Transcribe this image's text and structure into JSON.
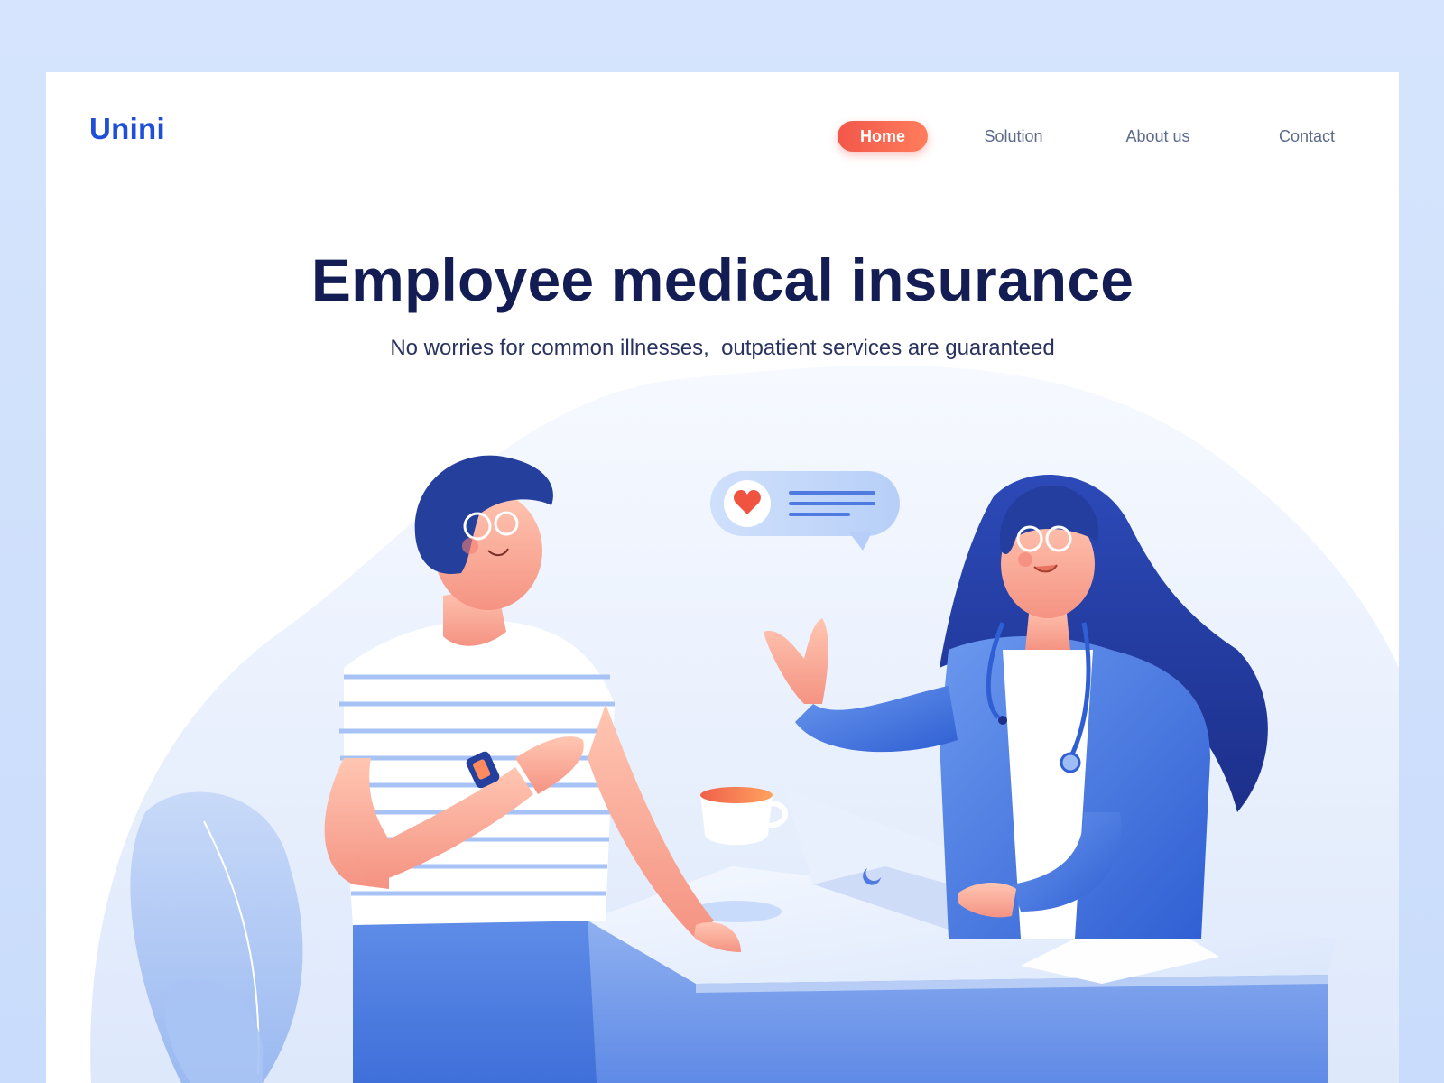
{
  "brand": {
    "logo_text": "Unini",
    "primary_color": "#1f4fd6",
    "accent_color": "#f2574a"
  },
  "nav": {
    "items": [
      {
        "label": "Home",
        "active": true
      },
      {
        "label": "Solution",
        "active": false
      },
      {
        "label": "About us",
        "active": false
      },
      {
        "label": "Contact",
        "active": false
      }
    ]
  },
  "hero": {
    "title": "Employee medical insurance",
    "subtitle": "No worries for common illnesses,  outpatient services are guaranteed"
  },
  "illustration": {
    "chat_bubble_icon": "heart-icon",
    "laptop_logo_icon": "moon-icon"
  }
}
